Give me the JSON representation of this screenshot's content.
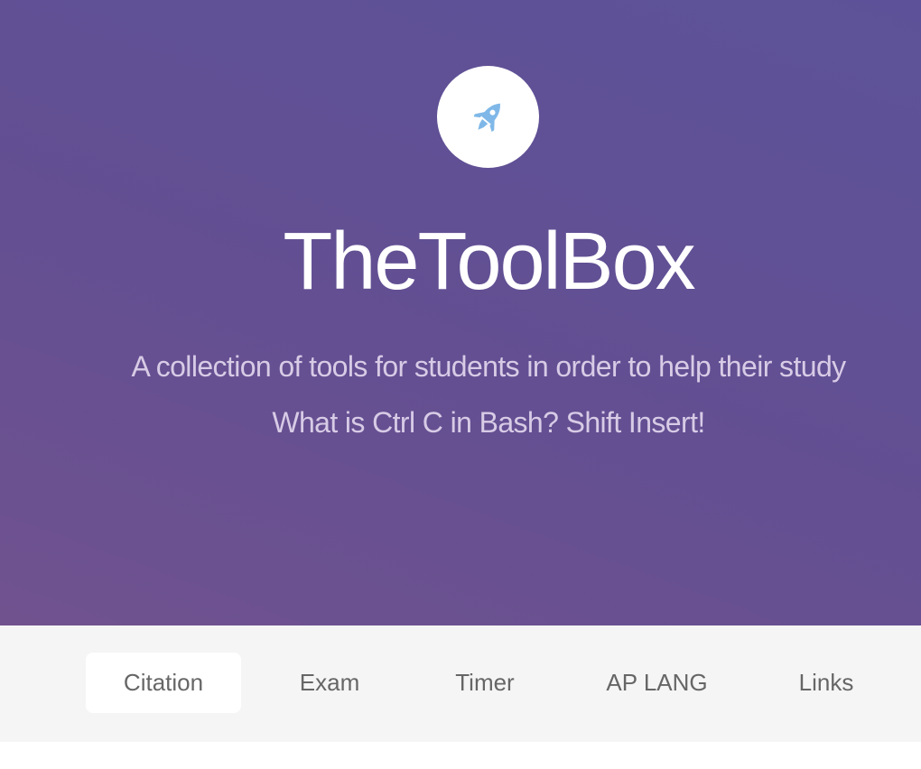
{
  "hero": {
    "logo_icon": "rocket-icon",
    "logo_color": "#7fb8e8",
    "title": "TheToolBox",
    "tagline_1": "A collection of tools for students in order to help their study",
    "tagline_2": "What is Ctrl C in Bash? Shift Insert!"
  },
  "nav": {
    "tabs": [
      {
        "label": "Citation",
        "active": true
      },
      {
        "label": "Exam",
        "active": false
      },
      {
        "label": "Timer",
        "active": false
      },
      {
        "label": "AP LANG",
        "active": false
      },
      {
        "label": "Links",
        "active": false
      }
    ]
  }
}
